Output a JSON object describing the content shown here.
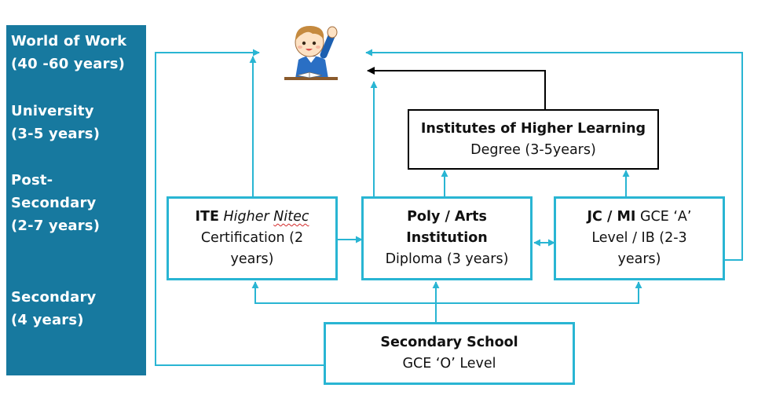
{
  "stages": [
    {
      "line1": "World of Work",
      "line2": "(40 -60 years)",
      "line3": ""
    },
    {
      "line1": "University",
      "line2": "(3-5 years)",
      "line3": ""
    },
    {
      "line1": "Post-",
      "line2": "Secondary",
      "line3": "(2-7 years)"
    },
    {
      "line1": "Secondary",
      "line2": "(4 years)",
      "line3": ""
    }
  ],
  "ihl": {
    "title": "Institutes of Higher Learning",
    "subtitle": "Degree (3-5years)"
  },
  "ite": {
    "bold": "ITE",
    "italic": "Higher",
    "italic_marked": "Nitec",
    "line2": "Certification (2",
    "line3": "years)"
  },
  "poly": {
    "line1": "Poly / Arts",
    "line2": "Institution",
    "line3": "Diploma (3 years)"
  },
  "jc": {
    "bold": "JC / MI",
    "rest": "GCE ‘A’",
    "line2": "Level / IB (2-3",
    "line3": "years)"
  },
  "secondary": {
    "title": "Secondary School",
    "subtitle": "GCE ‘O’ Level"
  },
  "colors": {
    "sidebar": "#17799f",
    "accent": "#29b5d3",
    "black_arrow": "#000000"
  },
  "icons": {
    "student": "student-raising-hand-icon"
  }
}
